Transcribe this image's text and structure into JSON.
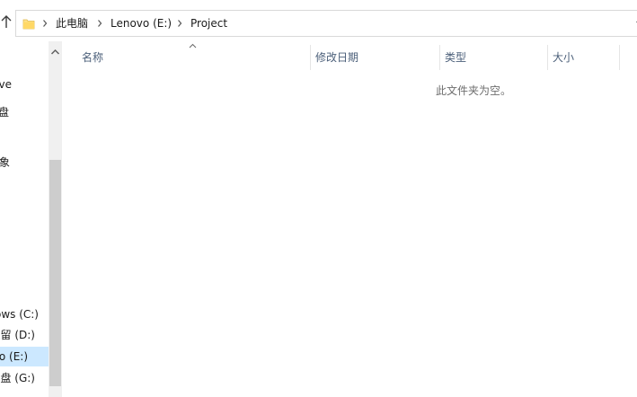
{
  "address_bar": {
    "breadcrumbs": [
      "此电脑",
      "Lenovo (E:)",
      "Project"
    ],
    "folder_icon": "folder-icon",
    "separator_icon": "chevron-right-icon",
    "dropdown_icon": "chevron-down-icon"
  },
  "nav": {
    "up_icon": "arrow-up-icon",
    "items": [
      {
        "label": "ive",
        "selected": false
      },
      {
        "label": "盘",
        "selected": false
      },
      {
        "label": "象",
        "selected": false
      },
      {
        "label": "ows (C:)",
        "selected": false
      },
      {
        "label": "保留 (D:)",
        "selected": false
      },
      {
        "label": "vo (E:)",
        "selected": true
      },
      {
        "label": "磁盘 (G:)",
        "selected": false
      }
    ]
  },
  "file_list": {
    "columns": [
      "名称",
      "修改日期",
      "类型",
      "大小"
    ],
    "empty_message": "此文件夹为空。"
  },
  "colors": {
    "selected_bg": "#cce8ff",
    "header_text": "#4c607a",
    "scrollbar_thumb": "#cdcdcd"
  }
}
